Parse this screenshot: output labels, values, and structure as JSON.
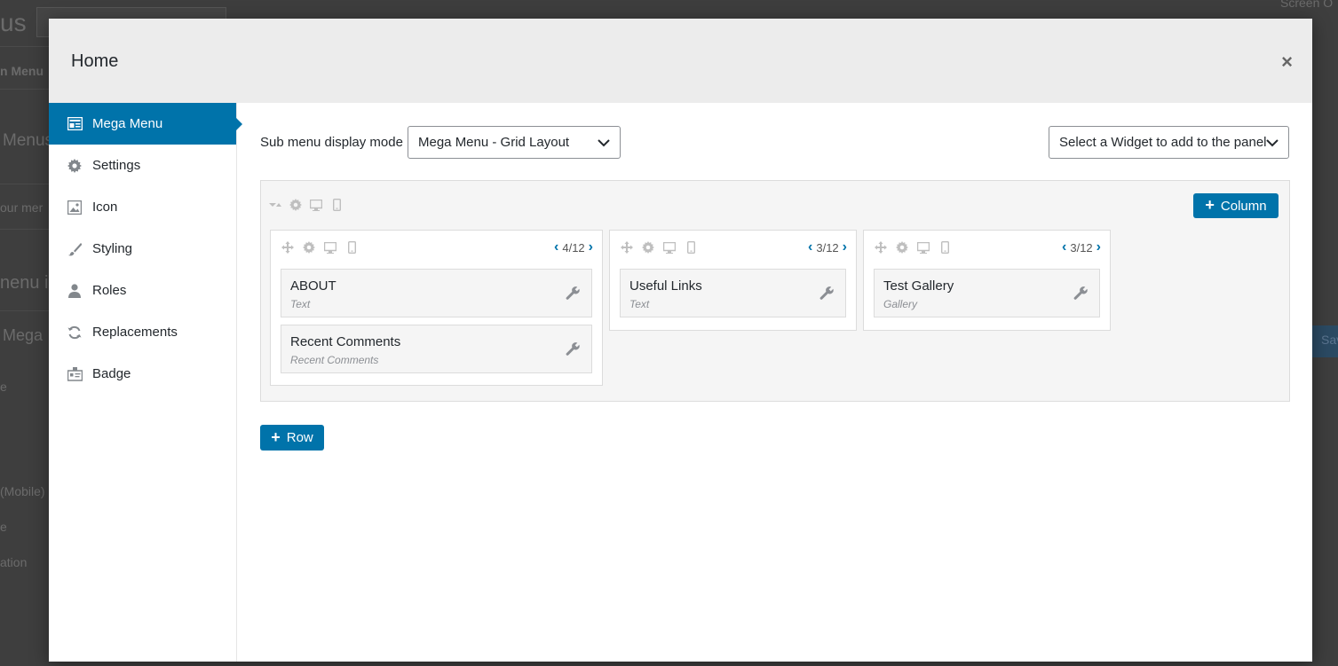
{
  "background": {
    "title_fragment": "us",
    "menu_fragment": "n Menu",
    "menus_fragment": "Menus",
    "your_menu_fragment": "our mer",
    "menu_items_fragment": "nenu i",
    "mega_fragment": "Mega",
    "e_fragment": "e",
    "mobile_fragment": "(Mobile)",
    "e2_fragment": "e",
    "ation_fragment": "ation",
    "screen_options": "Screen O",
    "save_fragment": "Sav"
  },
  "modal": {
    "title": "Home",
    "close_icon": "×"
  },
  "sidebar": {
    "items": [
      {
        "label": "Mega Menu",
        "icon": "table-layout-icon",
        "active": true
      },
      {
        "label": "Settings",
        "icon": "gear-icon"
      },
      {
        "label": "Icon",
        "icon": "image-icon"
      },
      {
        "label": "Styling",
        "icon": "brush-icon"
      },
      {
        "label": "Roles",
        "icon": "user-icon"
      },
      {
        "label": "Replacements",
        "icon": "refresh-icon"
      },
      {
        "label": "Badge",
        "icon": "badge-icon"
      }
    ]
  },
  "toolbar": {
    "mode_label": "Sub menu display mode",
    "mode_value": "Mega Menu - Grid Layout",
    "widget_select_value": "Select a Widget to add to the panel"
  },
  "grid": {
    "column_button": "Column",
    "row_button": "Row",
    "columns": [
      {
        "size": "4/12",
        "widgets": [
          {
            "title": "ABOUT",
            "type": "Text"
          },
          {
            "title": "Recent Comments",
            "type": "Recent Comments"
          }
        ]
      },
      {
        "size": "3/12",
        "widgets": [
          {
            "title": "Useful Links",
            "type": "Text"
          }
        ]
      },
      {
        "size": "3/12",
        "widgets": [
          {
            "title": "Test Gallery",
            "type": "Gallery"
          }
        ]
      }
    ]
  },
  "colors": {
    "accent": "#0073aa",
    "header_bg": "#ececec",
    "overlay": "#3e3e3e"
  }
}
